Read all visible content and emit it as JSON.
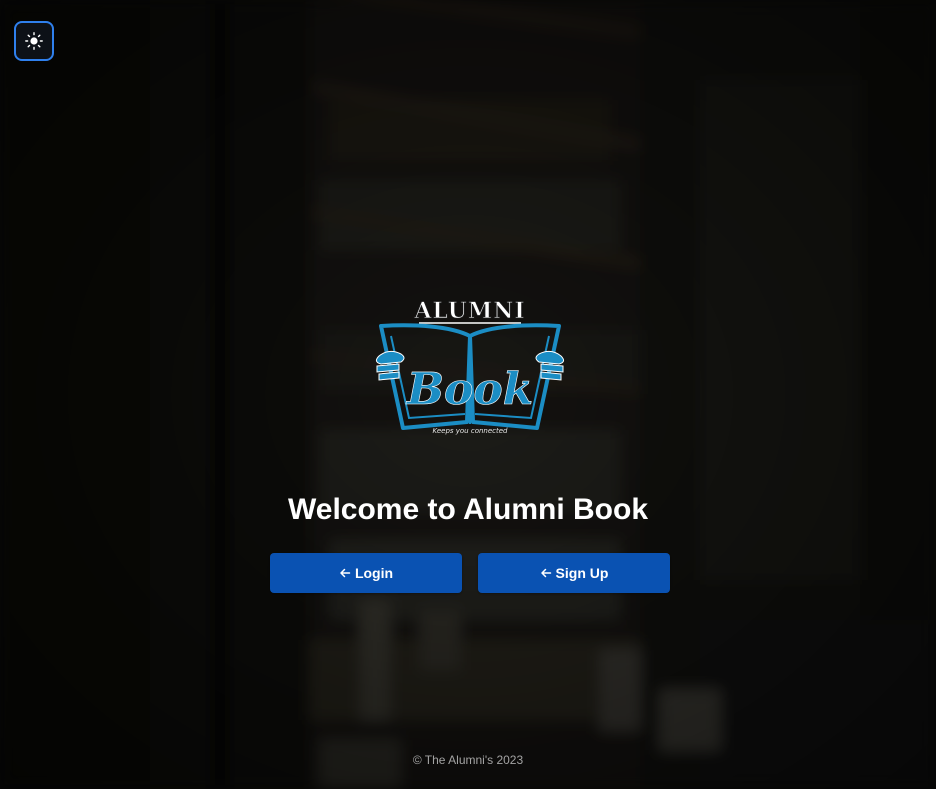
{
  "header": {
    "theme_toggle_icon": "sun-icon"
  },
  "logo": {
    "top_text": "ALUMNI",
    "main_text": "Book",
    "tagline": "Keeps you connected",
    "icon": "open-book-logo"
  },
  "main": {
    "title": "Welcome to Alumni Book",
    "login_label": "Login",
    "signup_label": "Sign Up",
    "button_icon": "arrow-left-icon"
  },
  "footer": {
    "copyright": "© The Alumni's 2023"
  },
  "colors": {
    "accent": "#0a52b2",
    "logo_blue": "#1b8dc4",
    "toggle_border": "#2f80ed"
  }
}
